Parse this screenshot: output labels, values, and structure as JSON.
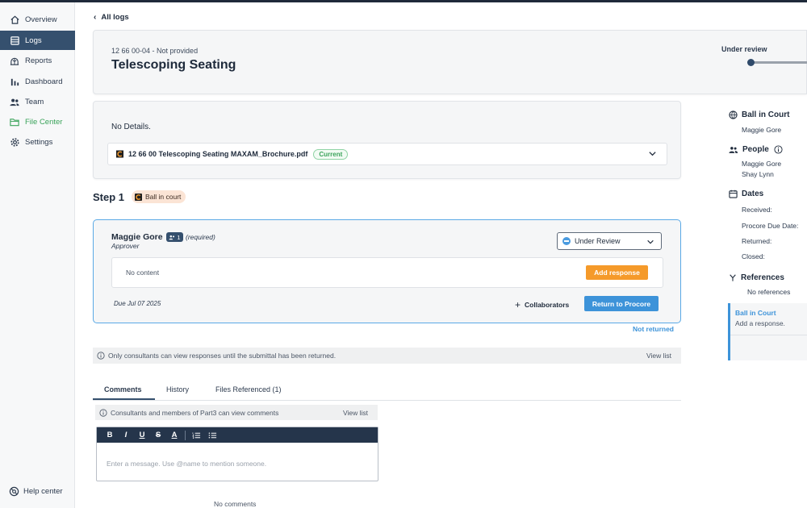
{
  "sidebar": {
    "items": [
      {
        "label": "Overview",
        "icon": "home-icon"
      },
      {
        "label": "Logs",
        "icon": "logs-icon",
        "active": true
      },
      {
        "label": "Reports",
        "icon": "reports-icon"
      },
      {
        "label": "Dashboard",
        "icon": "dashboard-icon"
      },
      {
        "label": "Team",
        "icon": "team-icon"
      },
      {
        "label": "File Center",
        "icon": "folder-icon"
      },
      {
        "label": "Settings",
        "icon": "gear-icon"
      }
    ],
    "help": "Help center"
  },
  "breadcrumb": {
    "back": "All logs"
  },
  "header": {
    "spec": "12 66 00-04 - Not provided",
    "title": "Telescoping Seating",
    "status": "Under review"
  },
  "details": {
    "text": "No Details.",
    "file_name": "12 66 00 Telescoping Seating MAXAM_Brochure.pdf",
    "file_badge": "Current"
  },
  "step": {
    "title": "Step 1",
    "badge": "Ball in court",
    "approver_name": "Maggie Gore",
    "approver_count": "1",
    "required": "(required)",
    "role": "Approver",
    "status_select": "Under Review",
    "no_content": "No content",
    "add_response": "Add response",
    "due": "Due Jul 07 2025",
    "collaborators": "Collaborators",
    "return_button": "Return to Procore",
    "not_returned": "Not returned"
  },
  "info_bar": {
    "text": "Only consultants can view responses until the submittal has been returned.",
    "view": "View list"
  },
  "tabs": [
    {
      "label": "Comments",
      "active": true
    },
    {
      "label": "History"
    },
    {
      "label": "Files Referenced (1)"
    }
  ],
  "comments": {
    "info": "Consultants and members of Part3 can view comments",
    "view": "View list",
    "placeholder": "Enter a message. Use @name to mention someone.",
    "empty": "No comments",
    "toolbar": [
      "B",
      "I",
      "U",
      "S",
      "A"
    ]
  },
  "right_panel": {
    "ball_in_court_title": "Ball in Court",
    "ball_in_court_name": "Maggie Gore",
    "people_title": "People",
    "people": [
      "Maggie Gore",
      "Shay Lynn"
    ],
    "dates_title": "Dates",
    "dates": [
      "Received:",
      "Procore Due Date:",
      "Returned:",
      "Closed:"
    ],
    "references_title": "References",
    "references_empty": "No references",
    "card_title": "Ball in Court",
    "card_text": "Add a response."
  },
  "colors": {
    "nav_active": "#35506e",
    "accent_blue": "#3d93d9",
    "orange": "#f59a2a",
    "green": "#3aa35a"
  }
}
